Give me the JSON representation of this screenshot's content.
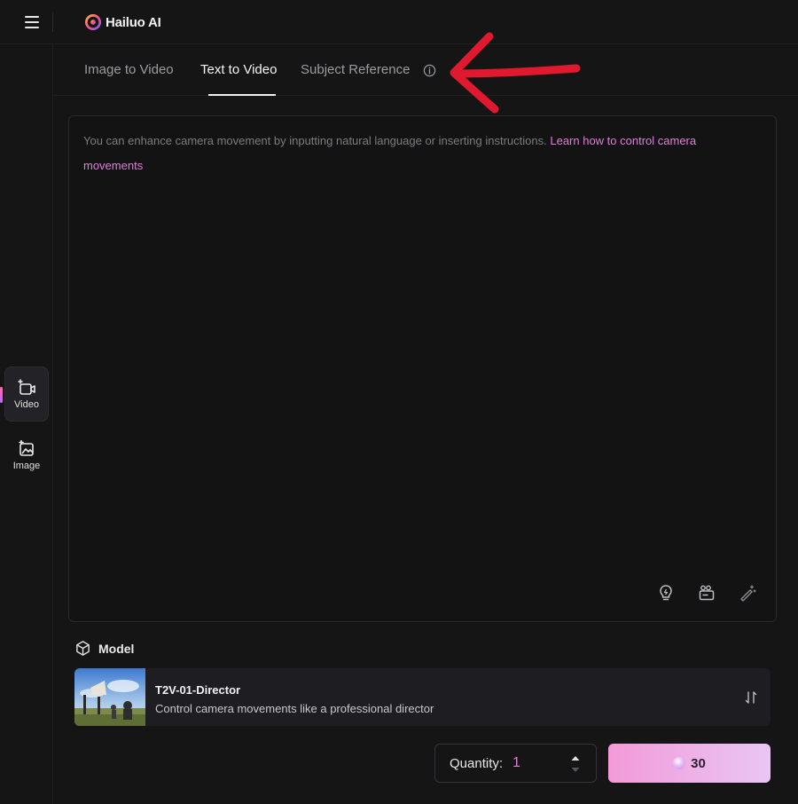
{
  "app": {
    "brand": "Hailuo AI"
  },
  "rail": {
    "items": [
      {
        "label": "Video",
        "icon": "video-plus-icon",
        "active": true
      },
      {
        "label": "Image",
        "icon": "image-plus-icon",
        "active": false
      }
    ]
  },
  "tabs": [
    {
      "label": "Image to Video",
      "active": false
    },
    {
      "label": "Text to Video",
      "active": true
    },
    {
      "label": "Subject Reference",
      "active": false,
      "icon": "info-icon"
    }
  ],
  "prompt": {
    "placeholder": "You can enhance camera movement by inputting natural language or inserting instructions.",
    "link": "Learn how to control camera movements",
    "tools": [
      "lightbulb-icon",
      "camera-clapper-icon",
      "magic-wand-icon"
    ]
  },
  "model": {
    "section_label": "Model",
    "name": "T2V-01-Director",
    "description": "Control camera movements like a professional director"
  },
  "quantity": {
    "label": "Quantity:",
    "value": "1"
  },
  "generate": {
    "cost": "30"
  },
  "colors": {
    "accent": "#e07ed9",
    "annotation_arrow": "#e0192f"
  }
}
